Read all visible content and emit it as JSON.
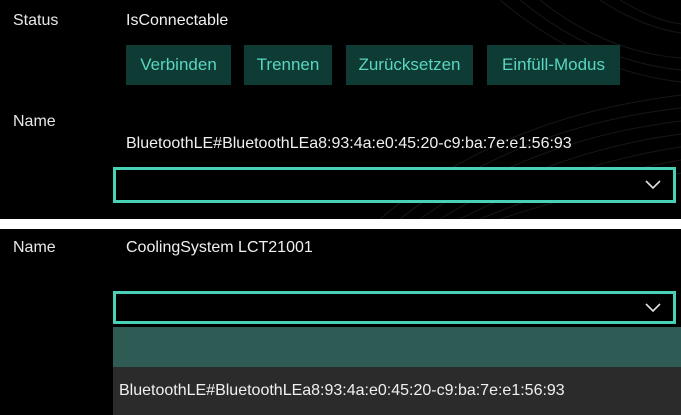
{
  "top": {
    "status_label": "Status",
    "status_value": "IsConnectable",
    "buttons": {
      "connect": "Verbinden",
      "disconnect": "Trennen",
      "reset": "Zurücksetzen",
      "fill_mode": "Einfüll-Modus"
    },
    "name_label": "Name",
    "name_value": "BluetoothLE#BluetoothLEa8:93:4a:e0:45:20-c9:ba:7e:e1:56:93",
    "combo_value": ""
  },
  "bottom": {
    "name_label": "Name",
    "name_value": "CoolingSystem LCT21001",
    "combo_value": "",
    "dropdown_items": [
      "",
      "BluetoothLE#BluetoothLEa8:93:4a:e0:45:20-c9:ba:7e:e1:56:93"
    ]
  },
  "icons": {
    "combo_arrow": "chevron-down-icon"
  },
  "colors": {
    "accent": "#48d1b7",
    "button_bg": "#0f3b35",
    "button_text": "#58d6c0",
    "dropdown_selected": "#2e5c55",
    "dropdown_bg": "#2b2b2b"
  }
}
